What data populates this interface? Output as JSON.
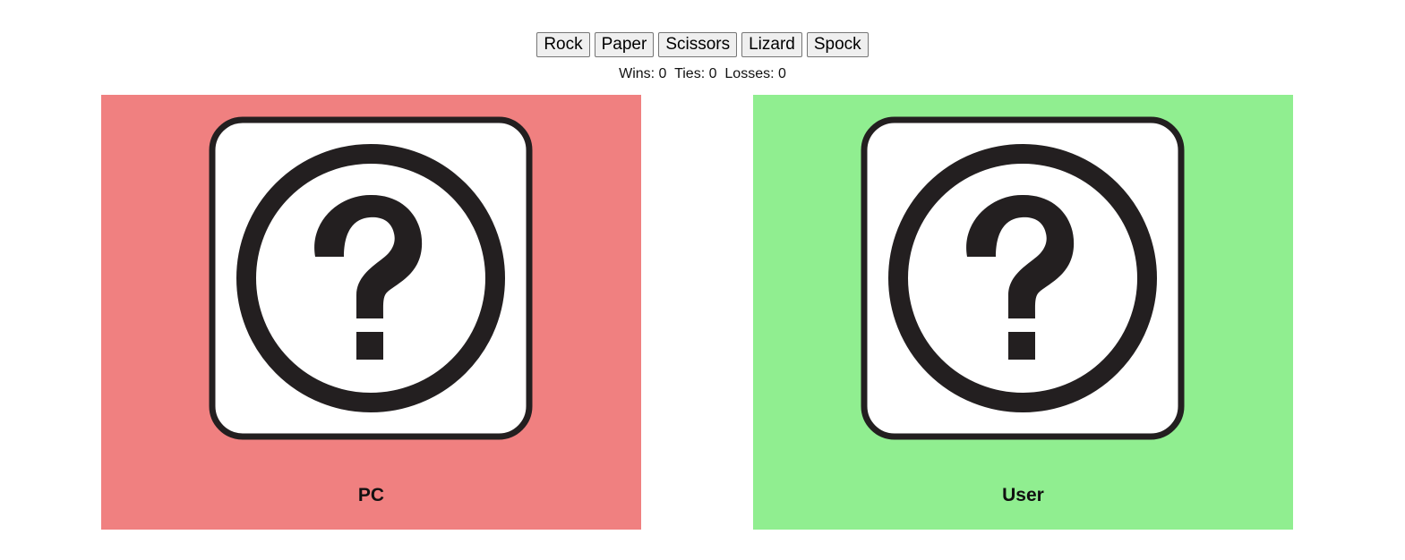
{
  "choices": {
    "rock": "Rock",
    "paper": "Paper",
    "scissors": "Scissors",
    "lizard": "Lizard",
    "spock": "Spock"
  },
  "score": {
    "wins_label": "Wins:",
    "wins": "0",
    "ties_label": "Ties:",
    "ties": "0",
    "losses_label": "Losses:",
    "losses": "0"
  },
  "pc_panel": {
    "label": "PC",
    "color": "#f08080",
    "icon": "question-mark-icon"
  },
  "user_panel": {
    "label": "User",
    "color": "#90ee90",
    "icon": "question-mark-icon"
  }
}
